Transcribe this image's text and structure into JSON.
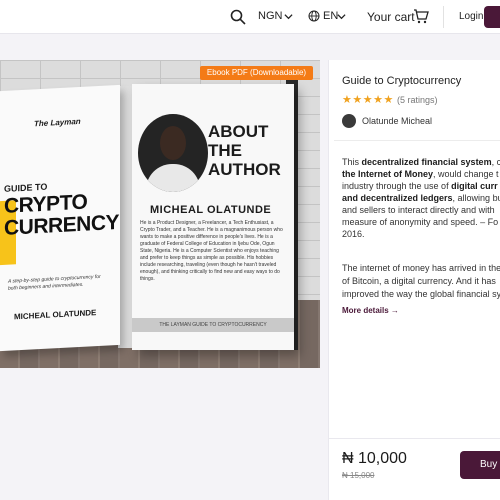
{
  "header": {
    "currency": "NGN",
    "language": "EN",
    "cart_label": "Your cart",
    "login_label": "Login"
  },
  "image": {
    "badge": "Ebook PDF (Downloadable)",
    "cover": {
      "series": "The Layman",
      "guide_to": "GUIDE TO",
      "title_line1": "CRYPTO",
      "title_line2": "CURRENCY",
      "subtitle": "A step-by-step guide to cryptocurrency for both beginners and intermediates.",
      "author": "MICHEAL OLATUNDE"
    },
    "back": {
      "heading": "ABOUT THE AUTHOR",
      "author": "MICHEAL OLATUNDE",
      "bio": "He is a Product Designer, a Freelancer, a Tech Enthusiast, a Crypto Trader, and a Teacher. He is a magnanimous person who wants to make a positive difference in people's lives. He is a graduate of Federal College of Education in Ijebu Ode, Ogun State, Nigeria. He is a Computer Scientist who enjoys teaching and prefer to keep things as simple as possible. His hobbies include researching, traveling (even though he hasn't traveled enough), and thinking critically to find new and easy ways to do things.",
      "footer": "THE LAYMAN GUIDE TO CRYPTOCURRENCY"
    }
  },
  "product": {
    "title": "Guide to Cryptocurrency",
    "stars": "★★★★★",
    "ratings": "(5 ratings)",
    "seller": "Olatunde Micheal",
    "desc_lines": [
      {
        "pre": "This ",
        "bold": "decentralized financial system",
        "post": ", c"
      },
      {
        "pre": "",
        "bold": "the Internet of Money",
        "post": ", would change t"
      },
      {
        "pre": "industry through the use of ",
        "bold": "digital curr",
        "post": ""
      },
      {
        "pre": "",
        "bold": "and decentralized ledgers",
        "post": ", allowing bu"
      },
      {
        "pre": "and sellers to interact directly and with",
        "bold": "",
        "post": ""
      },
      {
        "pre": "measure of anonymity and speed. – Fo",
        "bold": "",
        "post": ""
      },
      {
        "pre": "2016.",
        "bold": "",
        "post": ""
      }
    ],
    "desc2_lines": [
      "The internet of money has arrived in the",
      "of Bitcoin, a digital currency. And it has",
      "improved the way the global financial sy"
    ],
    "more_details": "More details →",
    "price": "₦ 10,000",
    "old_price": "₦ 15,000",
    "buy_label": "Buy n"
  },
  "colors": {
    "brand": "#4a1838",
    "badge": "#f47b16",
    "stars": "#f0a21f"
  }
}
